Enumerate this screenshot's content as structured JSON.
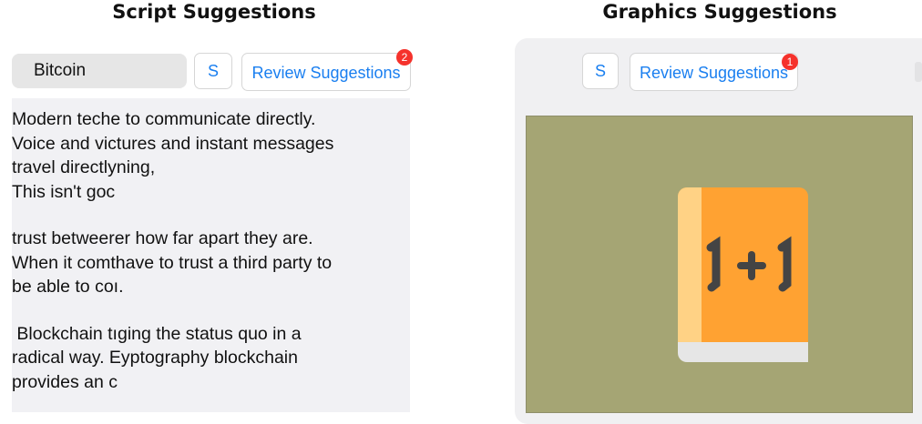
{
  "headings": {
    "script": "Script Suggestions",
    "graphics": "Graphics Suggestions"
  },
  "script_panel": {
    "title_value": "Bitcoin",
    "s_button": "S",
    "review_button": "Review Suggestions",
    "badge_count": "2",
    "paragraphs": [
      "Modern teche to communicate directly.\nVoice and victures and instant messages\ntravel directlyning,\nThis isn't goc",
      "trust betweerer how far apart they are.\nWhen it comthave to trust a third party to\nbe able to coı.",
      " Blockchain tıging the status quo in a\nradical way. Eyptography blockchain\nprovides an c"
    ]
  },
  "graphics_panel": {
    "s_button": "S",
    "review_button": "Review Suggestions",
    "badge_count": "1",
    "canvas_icon": "math-book-icon",
    "book_text": "1+1",
    "colors": {
      "canvas_bg": "#a5a574",
      "book_cover": "#ffa232",
      "book_spine": "#ffd285",
      "book_pages": "#e6e6e6",
      "book_text": "#444444"
    }
  },
  "colors": {
    "accent": "#1a7ff0",
    "badge": "#f5322c"
  }
}
